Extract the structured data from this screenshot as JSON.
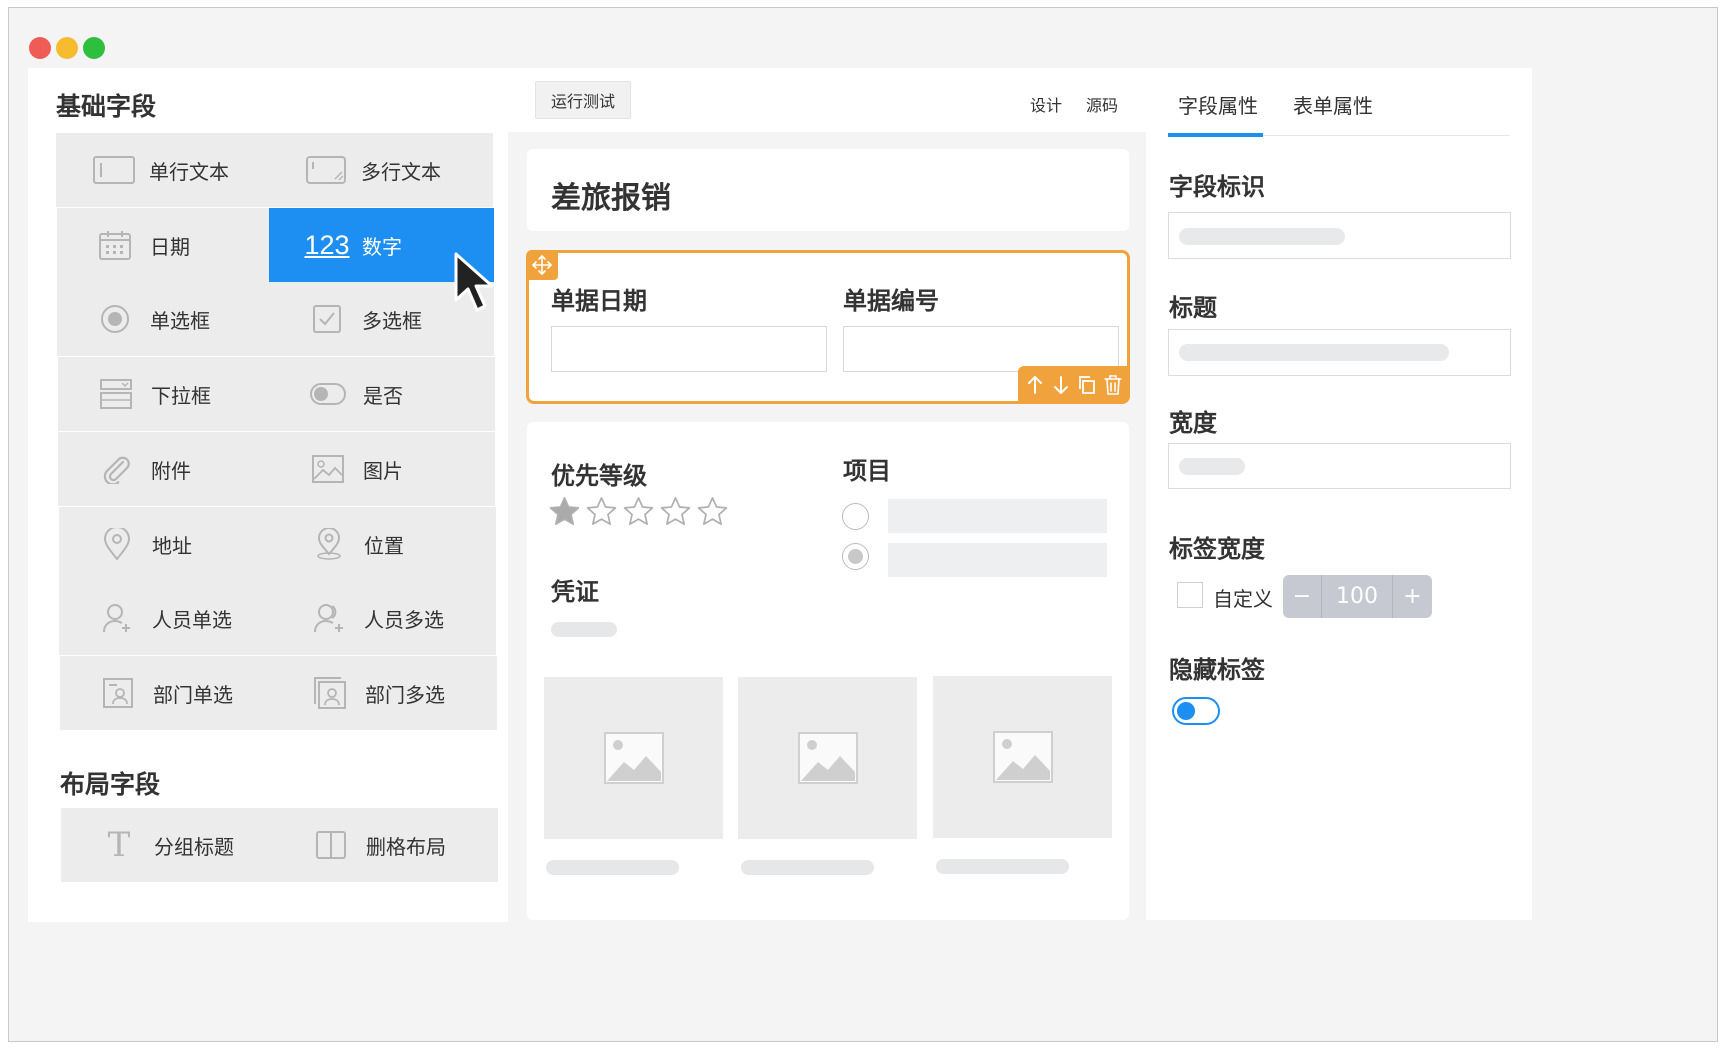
{
  "window": {
    "traffic_lights": {
      "close": "#ee5c55",
      "minimize": "#f7bb2f",
      "zoom": "#2fbf3f"
    }
  },
  "left": {
    "basic_title": "基础字段",
    "layout_title": "布局字段",
    "basic_fields": [
      {
        "label": "单行文本",
        "icon": "single-line-text-icon"
      },
      {
        "label": "多行文本",
        "icon": "multi-line-text-icon"
      },
      {
        "label": "日期",
        "icon": "calendar-icon"
      },
      {
        "label": "数字",
        "icon": "number-icon",
        "icon_text": "123",
        "active": true
      },
      {
        "label": "单选框",
        "icon": "radio-icon"
      },
      {
        "label": "多选框",
        "icon": "checkbox-icon"
      },
      {
        "label": "下拉框",
        "icon": "dropdown-icon"
      },
      {
        "label": "是否",
        "icon": "toggle-icon"
      },
      {
        "label": "附件",
        "icon": "paperclip-icon"
      },
      {
        "label": "图片",
        "icon": "image-icon"
      },
      {
        "label": "地址",
        "icon": "map-pin-icon"
      },
      {
        "label": "位置",
        "icon": "location-icon"
      },
      {
        "label": "人员单选",
        "icon": "user-icon"
      },
      {
        "label": "人员多选",
        "icon": "users-icon"
      },
      {
        "label": "部门单选",
        "icon": "department-icon"
      },
      {
        "label": "部门多选",
        "icon": "departments-icon"
      }
    ],
    "layout_fields": [
      {
        "label": "分组标题",
        "icon": "text-t-icon",
        "icon_text": "T"
      },
      {
        "label": "删格布局",
        "icon": "grid-layout-icon"
      }
    ]
  },
  "center": {
    "run_test": "运行测试",
    "design": "设计",
    "source": "源码",
    "form_title": "差旅报销",
    "selected_row": {
      "field1_label": "单据日期",
      "field2_label": "单据编号",
      "accent": "#f0a23c"
    },
    "priority_label": "优先等级",
    "priority_rating": 1,
    "priority_max": 5,
    "project_label": "项目",
    "voucher_label": "凭证"
  },
  "right": {
    "tabs": [
      "字段属性",
      "表单属性"
    ],
    "active_tab": 0,
    "accent": "#1e8ff2",
    "field_id_label": "字段标识",
    "title_label": "标题",
    "width_label": "宽度",
    "label_width_label": "标签宽度",
    "custom_label": "自定义",
    "stepper_minus": "−",
    "stepper_value": "100",
    "stepper_plus": "+",
    "hide_label": "隐藏标签"
  }
}
